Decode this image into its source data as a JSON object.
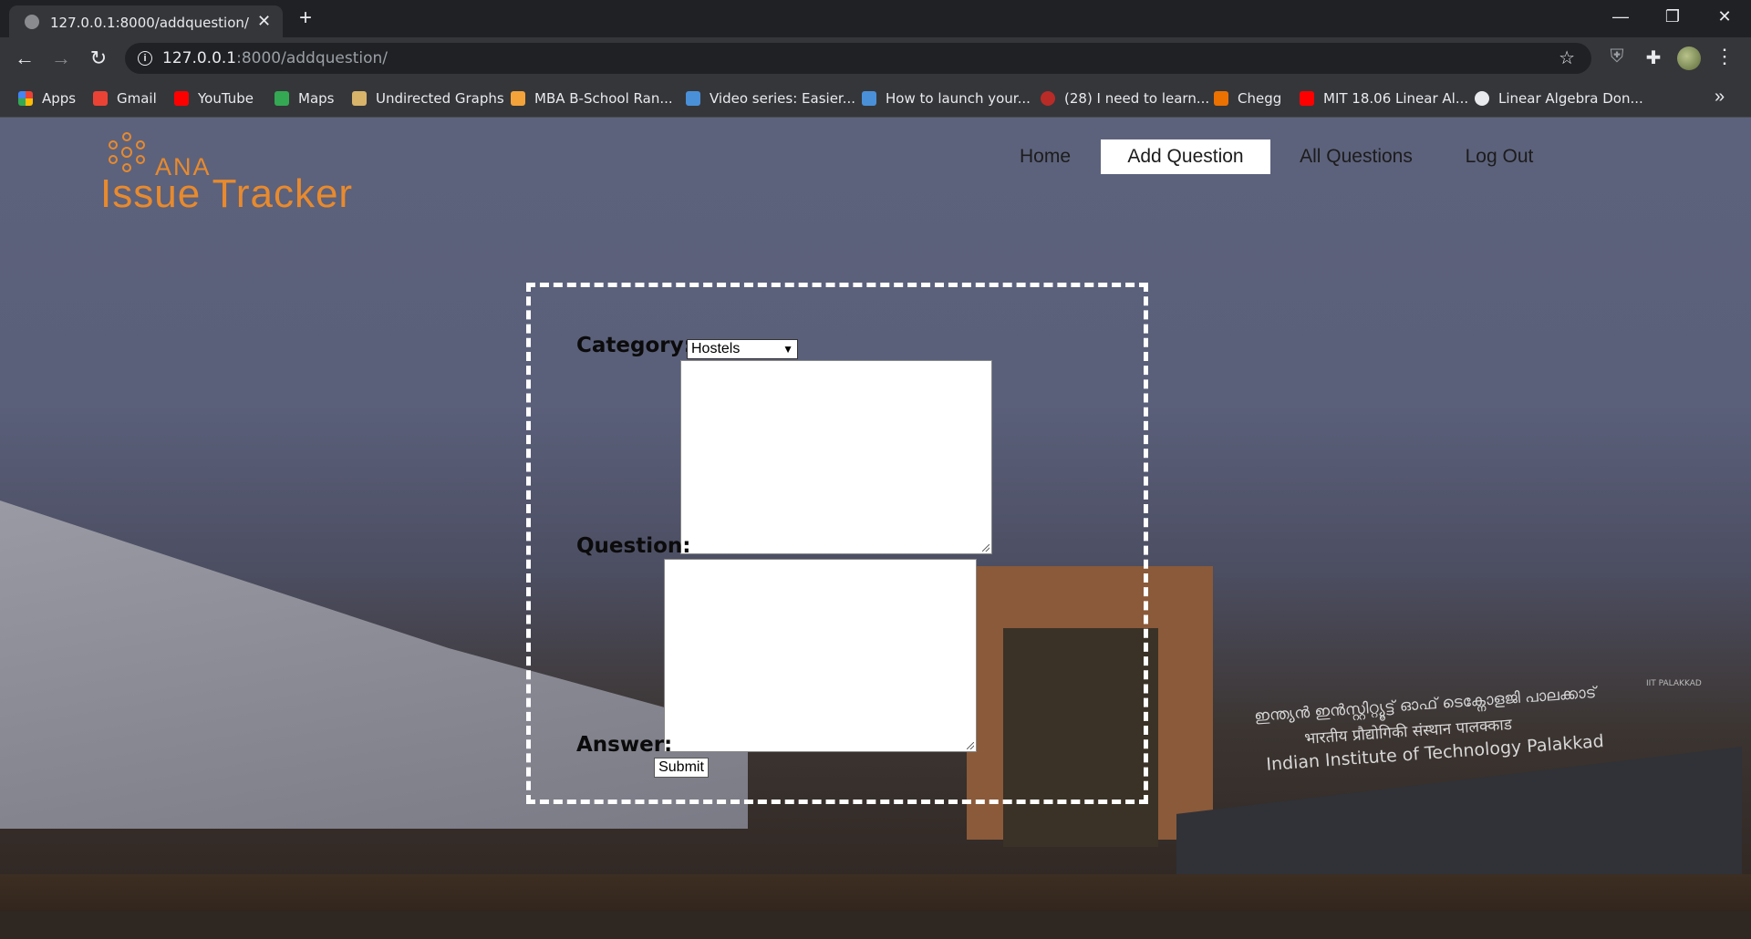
{
  "browser": {
    "tab_title": "127.0.0.1:8000/addquestion/",
    "url_host": "127.0.0.1",
    "url_path": ":8000/addquestion/",
    "bookmarks": [
      {
        "label": "Apps",
        "icon": "apps-grid-icon",
        "color": "#e94235"
      },
      {
        "label": "Gmail",
        "icon": "gmail-icon",
        "color": "#ea4335"
      },
      {
        "label": "YouTube",
        "icon": "youtube-icon",
        "color": "#ff0000"
      },
      {
        "label": "Maps",
        "icon": "maps-icon",
        "color": "#34a853"
      },
      {
        "label": "Undirected Graphs",
        "icon": "graph-icon",
        "color": "#d7b46a"
      },
      {
        "label": "MBA B-School Ran...",
        "icon": "mba-icon",
        "color": "#f3a33a"
      },
      {
        "label": "Video series: Easier...",
        "icon": "doc-icon",
        "color": "#4a90d9"
      },
      {
        "label": "How to launch your...",
        "icon": "doc-icon",
        "color": "#4a90d9"
      },
      {
        "label": "(28) I need to learn...",
        "icon": "quora-icon",
        "color": "#b92b27"
      },
      {
        "label": "Chegg",
        "icon": "chegg-icon",
        "color": "#eb7100"
      },
      {
        "label": "MIT 18.06 Linear Al...",
        "icon": "youtube-icon",
        "color": "#ff0000"
      },
      {
        "label": "Linear Algebra Don...",
        "icon": "globe-icon",
        "color": "#e8eaed"
      }
    ]
  },
  "site": {
    "logo_top": "ANA",
    "logo_main": "Issue Tracker",
    "logo_color": "#e88a2d",
    "nav": {
      "home": "Home",
      "add_question": "Add Question",
      "all_questions": "All Questions",
      "logout": "Log Out"
    }
  },
  "form": {
    "category_label": "Category:",
    "category_value": "Hostels",
    "question_label": "Question:",
    "question_value": "",
    "answer_label": "Answer:",
    "answer_value": "",
    "submit_label": "Submit"
  },
  "background_sign": {
    "line1": "ഇന്ത്യൻ ഇൻസ്റ്റിറ്റ്യൂട്ട് ഓഫ് ടെക്നോളജി പാലക്കാട്",
    "line2": "भारतीय प्रौद्योगिकी संस्थान पालक्काड",
    "line3": "Indian Institute of Technology Palakkad",
    "badge": "IIT PALAKKAD"
  }
}
